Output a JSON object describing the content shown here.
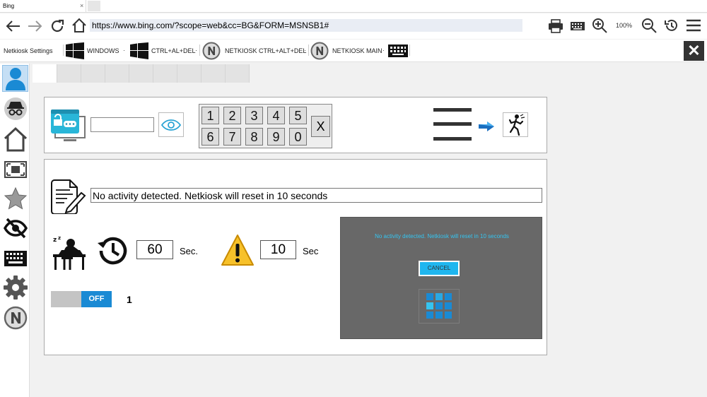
{
  "browser": {
    "tab_title": "Bing",
    "tab_close": "×",
    "url": "https://www.bing.com/?scope=web&cc=BG&FORM=MSNSB1#",
    "zoom": "100%"
  },
  "toolbar": {
    "settings_label": "Netkiosk Settings",
    "windows_label": "WINDOWS",
    "ctrl_alt_del_label": "CTRL+AL+DEL",
    "netkiosk_cad_label": "NETKIOSK CTRL+ALT+DEL",
    "netkiosk_main_label": "NETKIOSK MAIN",
    "dot": "·",
    "close_label": "✕"
  },
  "numpad": {
    "keys": [
      "1",
      "2",
      "3",
      "4",
      "5",
      "6",
      "7",
      "8",
      "9",
      "0"
    ],
    "clear": "X"
  },
  "inactivity": {
    "message": "No activity detected. Netkiosk will reset in 10 seconds",
    "idle_seconds": "60",
    "idle_unit": "Sec.",
    "warning_seconds": "10",
    "warning_unit": "Sec",
    "toggle_state": "OFF",
    "count": "1"
  },
  "preview": {
    "message": "No activity detected. Netkiosk will reset in 10 seconds",
    "cancel_label": "CANCEL"
  },
  "colors": {
    "accent": "#1a8ad4",
    "preview_bg": "#686868",
    "preview_text": "#35c4f0"
  }
}
